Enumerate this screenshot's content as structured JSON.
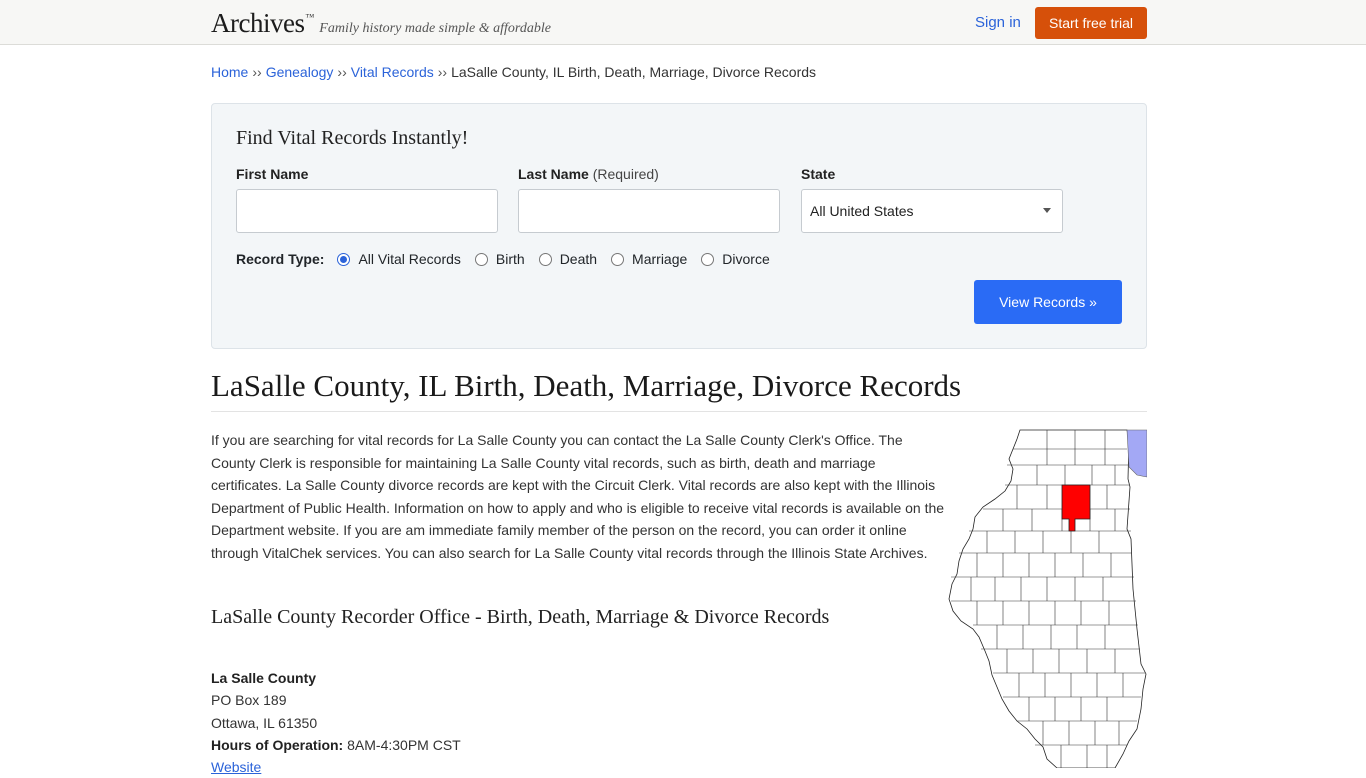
{
  "header": {
    "brand_name": "Archives",
    "brand_tm": "™",
    "tagline": "Family history made simple & affordable",
    "sign_in": "Sign in",
    "start_trial": "Start free trial",
    "accent_color": "#d6500a"
  },
  "breadcrumb": {
    "items": [
      "Home",
      "Genealogy",
      "Vital Records"
    ],
    "separator": "››",
    "current": "LaSalle County, IL Birth, Death, Marriage, Divorce Records"
  },
  "search": {
    "title": "Find Vital Records Instantly!",
    "first_name_label": "First Name",
    "first_name_value": "",
    "last_name_label": "Last Name",
    "last_name_required": "(Required)",
    "last_name_value": "",
    "state_label": "State",
    "state_selected": "All United States",
    "record_type_label": "Record Type:",
    "record_types": [
      "All Vital Records",
      "Birth",
      "Death",
      "Marriage",
      "Divorce"
    ],
    "record_type_selected": "All Vital Records",
    "submit": "View Records »",
    "button_color": "#2a6bf5"
  },
  "content": {
    "title": "LaSalle County, IL Birth, Death, Marriage, Divorce Records",
    "intro": "If you are searching for vital records for La Salle County you can contact the La Salle County Clerk's Office. The County Clerk is responsible for maintaining La Salle County vital records, such as birth, death and marriage certificates. La Salle County divorce records are kept with the Circuit Clerk. Vital records are also kept with the Illinois Department of Public Health. Information on how to apply and who is eligible to receive vital records is available on the Department website. If you are am immediate family member of the person on the record, you can order it online through VitalChek services. You can also search for La Salle County vital records through the Illinois State Archives.",
    "office_title": "LaSalle County Recorder Office - Birth, Death, Marriage & Divorce Records",
    "office_name": "La Salle County",
    "address_line1": "PO Box 189",
    "address_line2": "Ottawa, IL 61350",
    "hours_label": "Hours of Operation:",
    "hours_value": "8AM-4:30PM CST",
    "website_link": "Website"
  },
  "map": {
    "highlight_color": "#ff0000",
    "lake_color": "#a3a8f5"
  }
}
